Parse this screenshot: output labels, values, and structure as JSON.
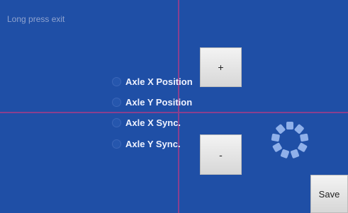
{
  "header": {
    "hint": "Long press exit"
  },
  "options": [
    {
      "label": "Axle X Position"
    },
    {
      "label": "Axle Y Position"
    },
    {
      "label": "Axle X Sync."
    },
    {
      "label": "Axle Y Sync."
    }
  ],
  "controls": {
    "plus_label": "+",
    "minus_label": "-",
    "save_label": "Save"
  },
  "icons": {
    "loading": "loading-spinner-icon"
  },
  "colors": {
    "background": "#1f4fa6",
    "crosshair": "#8a3f8e",
    "button": "#e6e6e6"
  }
}
